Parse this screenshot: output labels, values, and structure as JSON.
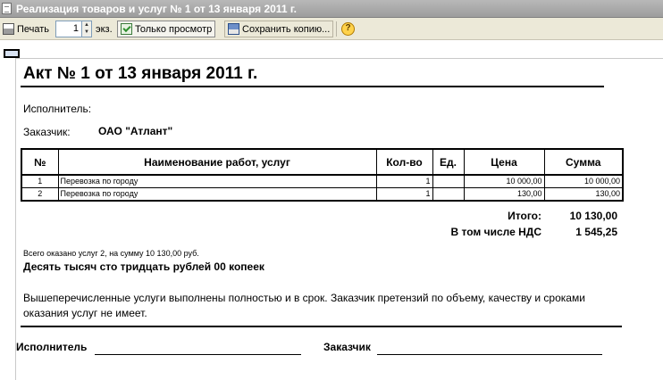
{
  "window": {
    "title": "Реализация товаров и услуг № 1 от 13 января 2011 г."
  },
  "toolbar": {
    "print_label": "Печать",
    "copies_value": "1",
    "copies_label": "экз.",
    "view_only_label": "Только просмотр",
    "save_copy_label": "Сохранить копию...",
    "help_symbol": "?"
  },
  "document": {
    "title": "Акт № 1 от 13 января 2011 г.",
    "executor_label": "Исполнитель:",
    "customer_label": "Заказчик:",
    "customer_name": "ОАО \"Атлант\"",
    "table": {
      "headers": [
        "№",
        "Наименование работ, услуг",
        "Кол-во",
        "Ед.",
        "Цена",
        "Сумма"
      ],
      "rows": [
        {
          "num": "1",
          "name": "Перевозка по городу",
          "qty": "1",
          "unit": "",
          "price": "10 000,00",
          "sum": "10 000,00"
        },
        {
          "num": "2",
          "name": "Перевозка по городу",
          "qty": "1",
          "unit": "",
          "price": "130,00",
          "sum": "130,00"
        }
      ]
    },
    "totals": {
      "total_label": "Итого:",
      "total_value": "10 130,00",
      "vat_label": "В том числе НДС",
      "vat_value": "1 545,25"
    },
    "summary_line": "Всего оказано услуг 2, на сумму 10 130,00 руб.",
    "amount_in_words": "Десять тысяч сто тридцать рублей 00 копеек",
    "statement": "Вышеперечисленные услуги выполнены полностью и в срок. Заказчик претензий по объему, качеству и сроками оказания услуг не имеет.",
    "signatures": {
      "executor": "Исполнитель",
      "customer": "Заказчик"
    }
  }
}
